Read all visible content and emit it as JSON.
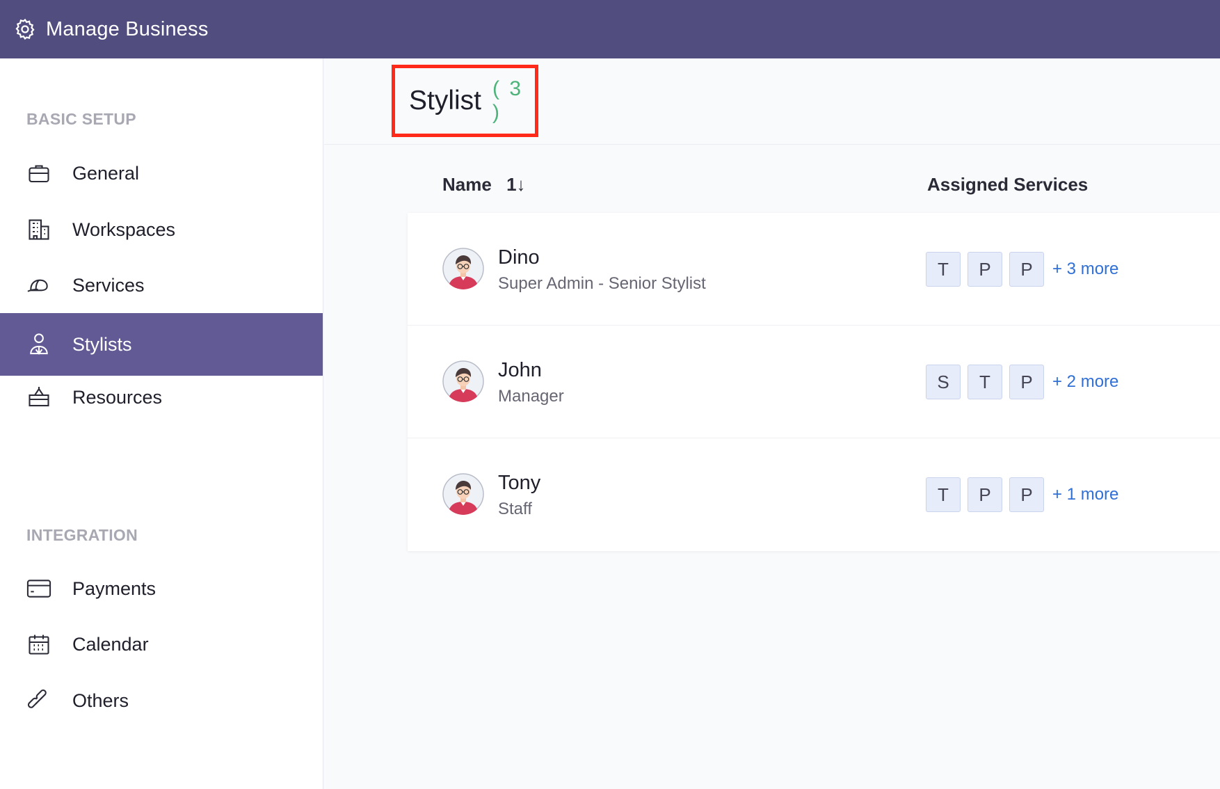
{
  "topbar": {
    "title": "Manage Business",
    "icon": "gear-icon"
  },
  "sidebar": {
    "sections": [
      {
        "label": "BASIC SETUP"
      },
      {
        "label": "INTEGRATION"
      }
    ],
    "items": [
      {
        "label": "General",
        "icon": "briefcase-icon"
      },
      {
        "label": "Workspaces",
        "icon": "building-icon"
      },
      {
        "label": "Services",
        "icon": "cap-icon"
      },
      {
        "label": "Stylists",
        "icon": "person-pin-icon",
        "active": true
      },
      {
        "label": "Resources",
        "icon": "desk-icon"
      },
      {
        "label": "Payments",
        "icon": "card-icon"
      },
      {
        "label": "Calendar",
        "icon": "calendar-icon"
      },
      {
        "label": "Others",
        "icon": "link-icon"
      }
    ]
  },
  "header": {
    "title": "Stylist",
    "count": "( 3 )"
  },
  "table": {
    "columns": {
      "name": "Name",
      "sort": "1↓",
      "services": "Assigned Services"
    },
    "rows": [
      {
        "name": "Dino",
        "role": "Super Admin - Senior Stylist",
        "chips": [
          "T",
          "P",
          "P"
        ],
        "more": "+ 3 more"
      },
      {
        "name": "John",
        "role": "Manager",
        "chips": [
          "S",
          "T",
          "P"
        ],
        "more": "+ 2 more"
      },
      {
        "name": "Tony",
        "role": "Staff",
        "chips": [
          "T",
          "P",
          "P"
        ],
        "more": "+ 1 more"
      }
    ]
  },
  "colors": {
    "topbar": "#514d7e",
    "active_nav": "#625a95",
    "count": "#4db37a",
    "link": "#2f6fd6",
    "highlight_box": "#ff2a1a"
  }
}
